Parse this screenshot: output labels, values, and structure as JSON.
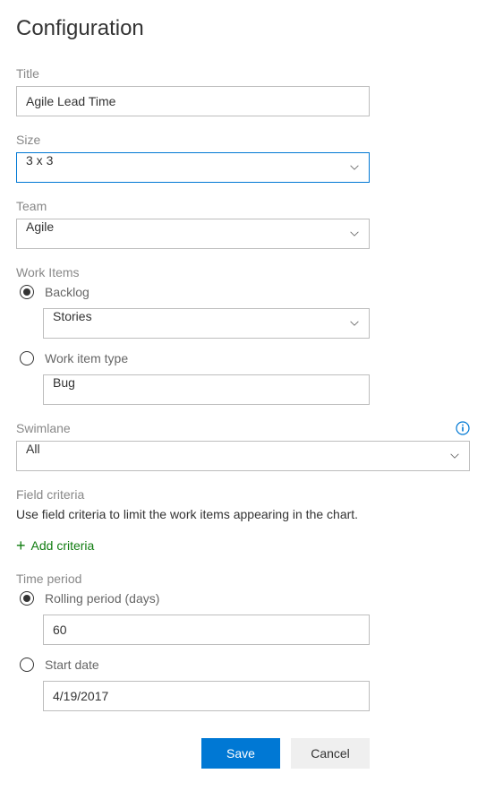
{
  "header": {
    "title": "Configuration"
  },
  "fields": {
    "title": {
      "label": "Title",
      "value": "Agile Lead Time"
    },
    "size": {
      "label": "Size",
      "value": "3 x 3"
    },
    "team": {
      "label": "Team",
      "value": "Agile"
    },
    "workItems": {
      "label": "Work Items",
      "backlog": {
        "label": "Backlog",
        "value": "Stories"
      },
      "workItemType": {
        "label": "Work item type",
        "value": "Bug"
      }
    },
    "swimlane": {
      "label": "Swimlane",
      "value": "All"
    },
    "fieldCriteria": {
      "label": "Field criteria",
      "description": "Use field criteria to limit the work items appearing in the chart.",
      "addLabel": "Add criteria"
    },
    "timePeriod": {
      "label": "Time period",
      "rolling": {
        "label": "Rolling period (days)",
        "value": "60"
      },
      "startDate": {
        "label": "Start date",
        "value": "4/19/2017"
      }
    }
  },
  "buttons": {
    "save": "Save",
    "cancel": "Cancel"
  }
}
